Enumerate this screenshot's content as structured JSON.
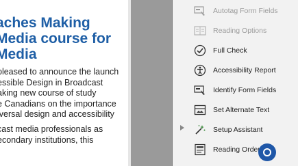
{
  "document": {
    "title_lines": [
      "aches Making",
      "Media course for",
      "Media"
    ],
    "body_lines": [
      "pleased to announce the launch",
      "essible Design in Broadcast",
      "aking new course of study",
      "e Canadians on the importance",
      "iversal design and accessibility"
    ],
    "body2_lines": [
      "cast media professionals as",
      "econdary institutions, this"
    ]
  },
  "tools_panel": {
    "items": [
      {
        "label": "Autotag Form Fields",
        "icon": "autotag-form-fields-icon",
        "enabled": false
      },
      {
        "label": "Reading Options",
        "icon": "reading-options-icon",
        "enabled": false
      },
      {
        "label": "Full Check",
        "icon": "full-check-icon",
        "enabled": true
      },
      {
        "label": "Accessibility Report",
        "icon": "accessibility-report-icon",
        "enabled": true
      },
      {
        "label": "Identify Form Fields",
        "icon": "identify-form-fields-icon",
        "enabled": true
      },
      {
        "label": "Set Alternate Text",
        "icon": "set-alternate-text-icon",
        "enabled": true
      },
      {
        "label": "Setup Assistant",
        "icon": "setup-assistant-icon",
        "enabled": true
      },
      {
        "label": "Reading Order",
        "icon": "reading-order-icon",
        "enabled": true
      }
    ]
  },
  "colors": {
    "title_blue": "#1f5fa6",
    "cursor_blue": "#1f57a8",
    "panel_bg": "#f2f2f2",
    "viewer_gray": "#9a9a9a"
  }
}
